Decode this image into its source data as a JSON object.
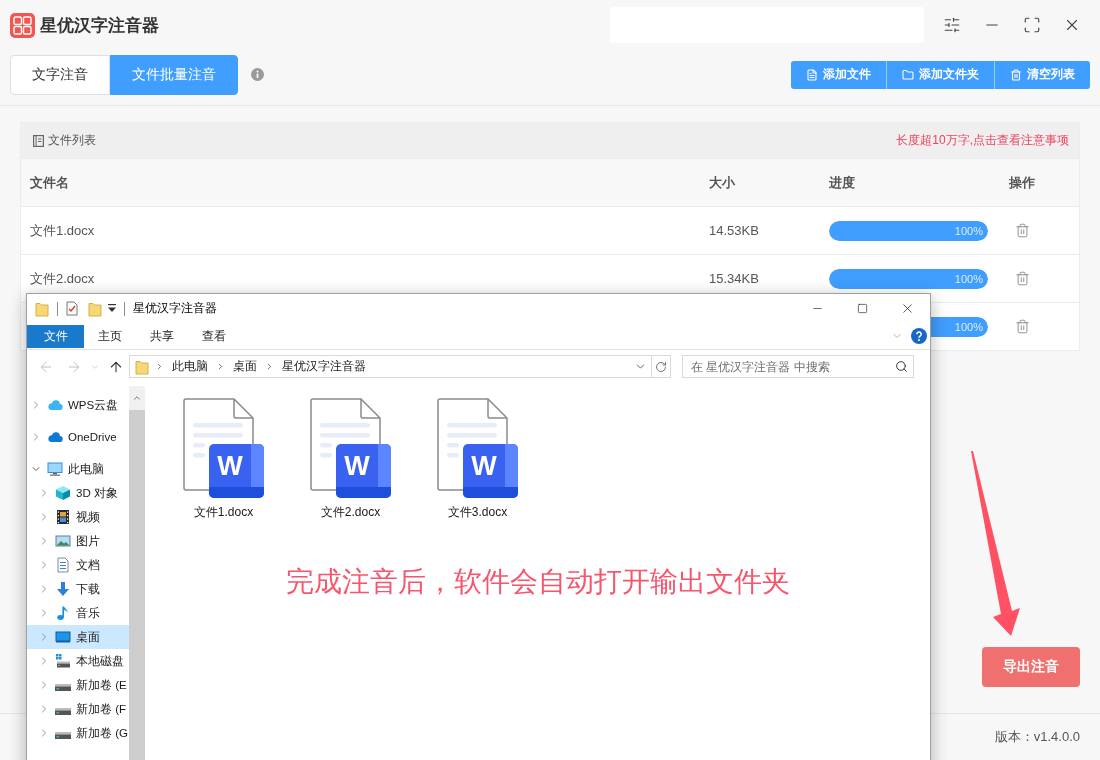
{
  "app": {
    "title": "星优汉字注音器"
  },
  "mode_tabs": [
    {
      "label": "文字注音",
      "selected": false
    },
    {
      "label": "文件批量注音",
      "selected": true
    }
  ],
  "toolbar": [
    {
      "label": "添加文件",
      "kind": "file"
    },
    {
      "label": "添加文件夹",
      "kind": "folder"
    },
    {
      "label": "清空列表",
      "kind": "clear"
    }
  ],
  "file_list": {
    "title": "文件列表",
    "notice": "长度超10万字,点击查看注意事项",
    "columns": [
      "文件名",
      "大小",
      "进度",
      "操作"
    ],
    "rows": [
      {
        "name": "文件1.docx",
        "size": "14.53KB",
        "progress": "100%",
        "level": 1
      },
      {
        "name": "文件2.docx",
        "size": "15.34KB",
        "progress": "100%",
        "level": 1
      },
      {
        "progress": "100%",
        "level": 1
      }
    ]
  },
  "export_button": "导出注音",
  "version": "版本：v1.4.0.0",
  "explorer": {
    "title": "星优汉字注音器",
    "ribbon_tabs": [
      {
        "label": "文件",
        "selected": true
      },
      {
        "label": "主页",
        "selected": false
      },
      {
        "label": "共享",
        "selected": false
      },
      {
        "label": "查看",
        "selected": false
      }
    ],
    "breadcrumb": [
      "此电脑",
      "桌面",
      "星优汉字注音器"
    ],
    "search": {
      "placeholder": "在 星优汉字注音器 中搜索"
    },
    "nav": [
      {
        "label": "WPS云盘",
        "kind": "wps",
        "expanded": false,
        "selected": false
      },
      {
        "label": "OneDrive",
        "kind": "onedrive",
        "expanded": false,
        "selected": false
      },
      {
        "label": "此电脑",
        "kind": "pc",
        "expanded": true,
        "selected": false,
        "children": [
          {
            "label": "3D 对象",
            "kind": "objects",
            "expanded": false,
            "selected": false
          },
          {
            "label": "视频",
            "kind": "videos",
            "expanded": false,
            "selected": false
          },
          {
            "label": "图片",
            "kind": "pictures",
            "expanded": false,
            "selected": false
          },
          {
            "label": "文档",
            "kind": "documents",
            "expanded": false,
            "selected": false
          },
          {
            "label": "下载",
            "kind": "downloads",
            "expanded": false,
            "selected": false
          },
          {
            "label": "音乐",
            "kind": "music",
            "expanded": false,
            "selected": false
          },
          {
            "label": "桌面",
            "kind": "desktop",
            "expanded": false,
            "selected": true
          },
          {
            "label": "本地磁盘",
            "kind": "systemdisk",
            "expanded": false,
            "selected": false
          },
          {
            "label": "新加卷 (E",
            "kind": "disk",
            "expanded": false,
            "selected": false
          },
          {
            "label": "新加卷 (F",
            "kind": "disk",
            "expanded": false,
            "selected": false
          },
          {
            "label": "新加卷 (G",
            "kind": "disk",
            "expanded": false,
            "selected": false
          }
        ]
      }
    ],
    "files": [
      {
        "name": "文件1.docx",
        "icon_letter": "W"
      },
      {
        "name": "文件2.docx",
        "icon_letter": "W"
      },
      {
        "name": "文件3.docx",
        "icon_letter": "W"
      }
    ]
  },
  "annotation": "完成注音后，软件会自动打开输出文件夹"
}
